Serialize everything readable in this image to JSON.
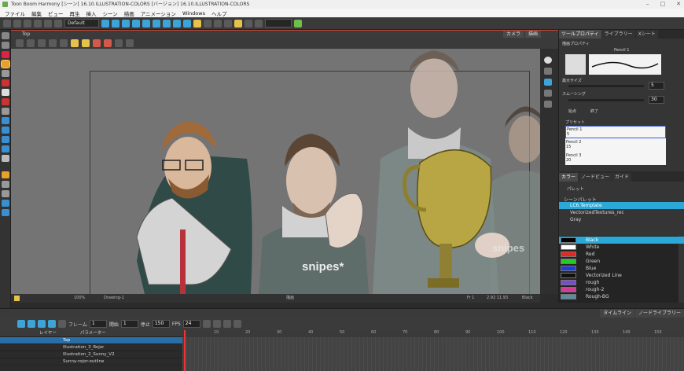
{
  "window": {
    "title": "Toon Boom Harmony [シーン] 16.10.ILLUSTRATION-COLORS [バージョン] 16.10.ILLUSTRATION-COLORS"
  },
  "menu": [
    "ファイル",
    "編集",
    "ビュー",
    "再生",
    "挿入",
    "シーン",
    "描画",
    "アニメーション",
    "Windows",
    "ヘルプ"
  ],
  "toolbar": {
    "workspace": "Default"
  },
  "view": {
    "name": "Top",
    "tabs": [
      "カメラ",
      "描画"
    ],
    "zoom": "100%",
    "layer": "Drawing-1",
    "status_mid": "描画",
    "frame": "Fr 1",
    "coords": "2.92 11.93",
    "palette_state": "Black"
  },
  "right_panel": {
    "tabs": [
      "ツールプロパティ",
      "ライブラリー",
      "Xシート"
    ],
    "pencil_title": "描画プロパティ",
    "pencil_name": "Pencil 1",
    "max_size_label": "最大サイズ",
    "max_size": "5",
    "smooth_label": "スムーシング",
    "smooth": "30",
    "start_label": "始点",
    "end_label": "終了",
    "preset_label": "プリセット",
    "presets": [
      {
        "name": "Pencil 1",
        "size": "5"
      },
      {
        "name": "Pencil 2",
        "size": "15"
      },
      {
        "name": "Pencil 3",
        "size": "20"
      }
    ]
  },
  "color_panel": {
    "tabs": [
      "カラー",
      "ノードビュー",
      "ガイド"
    ],
    "palette_label": "パレット",
    "scene_palette": "シーンパレット",
    "palettes": [
      "LC6.Template",
      "VectorizedTextures_rec",
      "Gray"
    ],
    "colors": [
      {
        "name": "Black",
        "hex": "#000000"
      },
      {
        "name": "White",
        "hex": "#ffffff"
      },
      {
        "name": "Red",
        "hex": "#e8281e"
      },
      {
        "name": "Green",
        "hex": "#28c828"
      },
      {
        "name": "Blue",
        "hex": "#1e3cdc"
      },
      {
        "name": "Vectorized Line",
        "hex": "#101010"
      },
      {
        "name": "rough",
        "hex": "#7a4bd0"
      },
      {
        "name": "rough-2",
        "hex": "#d23c96"
      },
      {
        "name": "Rough-BG",
        "hex": "#5f8aa0"
      }
    ]
  },
  "timeline": {
    "tabs": [
      "タイムライン",
      "ノードライブラリー"
    ],
    "frame_label": "フレーム",
    "frame": "1",
    "start_label": "開始",
    "start": "1",
    "stop_label": "停止",
    "stop": "150",
    "fps_label": "FPS",
    "fps": "24",
    "layer_header": "レイヤー",
    "param_header": "パラメーター",
    "layers": [
      "Top",
      "Illustration_3_Rojor",
      "Illustration_2_Sunny_V2",
      "Sunny-rojor-outline"
    ],
    "ruler": [
      "10",
      "20",
      "30",
      "40",
      "50",
      "60",
      "70",
      "80",
      "90",
      "100",
      "110",
      "120",
      "130",
      "140",
      "150"
    ]
  }
}
